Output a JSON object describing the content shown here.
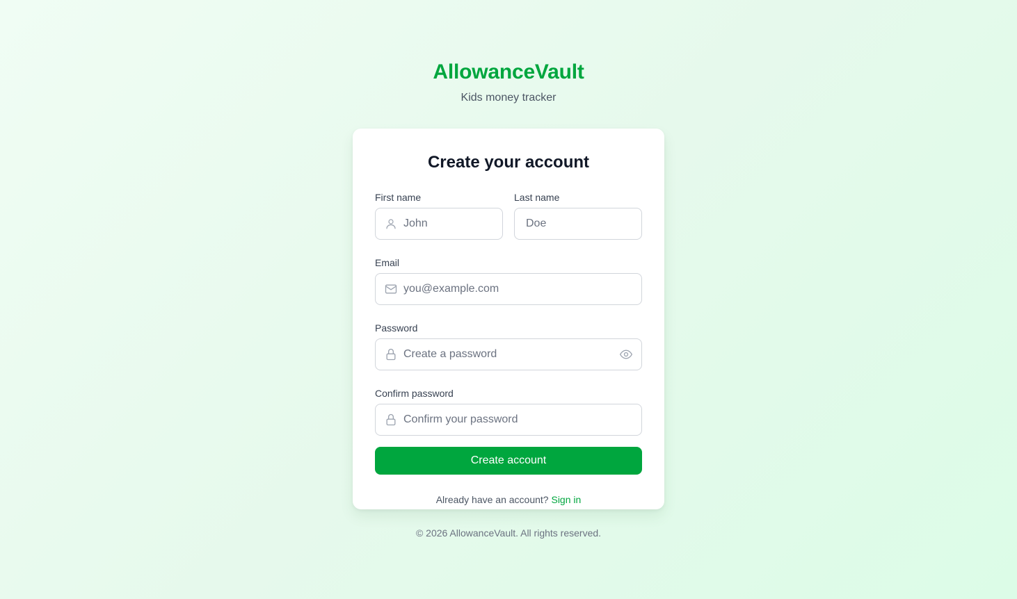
{
  "brand": {
    "title": "AllowanceVault",
    "subtitle": "Kids money tracker",
    "accent_color": "#00a63e"
  },
  "form": {
    "title": "Create your account",
    "first_name": {
      "label": "First name",
      "placeholder": "John",
      "value": "",
      "icon": "user-icon"
    },
    "last_name": {
      "label": "Last name",
      "placeholder": "Doe",
      "value": ""
    },
    "email": {
      "label": "Email",
      "placeholder": "you@example.com",
      "value": "",
      "icon": "mail-icon"
    },
    "password": {
      "label": "Password",
      "placeholder": "Create a password",
      "value": "",
      "icon": "lock-icon",
      "trailing_icon": "eye-icon"
    },
    "confirm_password": {
      "label": "Confirm password",
      "placeholder": "Confirm your password",
      "value": "",
      "icon": "lock-icon"
    },
    "submit_label": "Create account",
    "signin_prompt": "Already have an account?",
    "signin_link": "Sign in"
  },
  "footer": {
    "text": "© 2026 AllowanceVault. All rights reserved."
  }
}
